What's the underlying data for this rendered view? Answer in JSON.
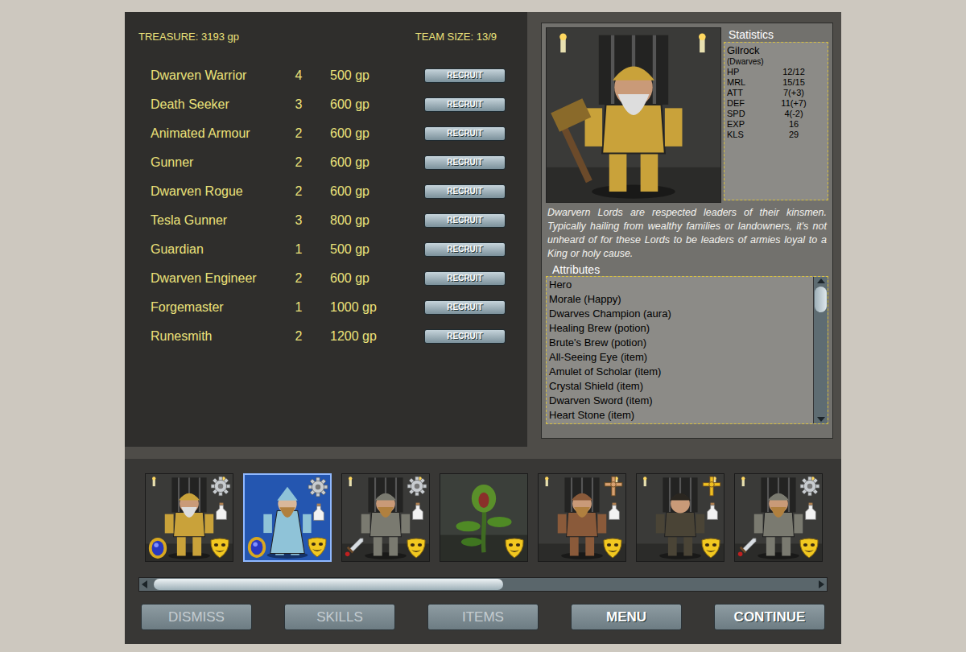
{
  "header": {
    "treasure": "TREASURE: 3193 gp",
    "team_size": "TEAM SIZE: 13/9"
  },
  "recruits": [
    {
      "name": "Dwarven Warrior",
      "count": "4",
      "price": "500 gp",
      "button": "RECRUIT"
    },
    {
      "name": "Death Seeker",
      "count": "3",
      "price": "600 gp",
      "button": "RECRUIT"
    },
    {
      "name": "Animated Armour",
      "count": "2",
      "price": "600 gp",
      "button": "RECRUIT"
    },
    {
      "name": "Gunner",
      "count": "2",
      "price": "600 gp",
      "button": "RECRUIT"
    },
    {
      "name": "Dwarven Rogue",
      "count": "2",
      "price": "600 gp",
      "button": "RECRUIT"
    },
    {
      "name": "Tesla Gunner",
      "count": "3",
      "price": "800 gp",
      "button": "RECRUIT"
    },
    {
      "name": "Guardian",
      "count": "1",
      "price": "500 gp",
      "button": "RECRUIT"
    },
    {
      "name": "Dwarven Engineer",
      "count": "2",
      "price": "600 gp",
      "button": "RECRUIT"
    },
    {
      "name": "Forgemaster",
      "count": "1",
      "price": "1000 gp",
      "button": "RECRUIT"
    },
    {
      "name": "Runesmith",
      "count": "2",
      "price": "1200 gp",
      "button": "RECRUIT"
    }
  ],
  "unit": {
    "name": "Gilrock",
    "faction": "(Dwarves)",
    "stats_title": "Statistics",
    "stats": [
      {
        "label": "HP",
        "value": "12/12"
      },
      {
        "label": "MRL",
        "value": "15/15"
      },
      {
        "label": "ATT",
        "value": "7(+3)"
      },
      {
        "label": "DEF",
        "value": "11(+7)"
      },
      {
        "label": "SPD",
        "value": "4(-2)"
      },
      {
        "label": "EXP",
        "value": "16"
      },
      {
        "label": "KLS",
        "value": "29"
      }
    ],
    "description": "Dwarvern Lords are respected leaders of their kinsmen. Typically hailing from wealthy families or landowners, it's not unheard of for these Lords to be leaders of armies loyal to a King or holy cause.",
    "attributes_title": "Attributes",
    "attributes": [
      "Hero",
      "Morale (Happy)",
      "Dwarves Champion (aura)",
      "Healing Brew (potion)",
      "Brute's Brew (potion)",
      "All-Seeing Eye (item)",
      "Amulet of Scholar (item)",
      "Crystal Shield (item)",
      "Dwarven Sword (item)",
      "Heart Stone (item)"
    ],
    "attributes_scroll": {
      "level": 0.2
    }
  },
  "team": {
    "scroll": {
      "level": 0.53
    },
    "portraits": [
      {
        "kind": "lord",
        "selected": false,
        "badges": [
          "gear",
          "potion",
          "amulet",
          "mask"
        ]
      },
      {
        "kind": "mage",
        "selected": true,
        "badges": [
          "gear",
          "potion",
          "amulet",
          "mask"
        ]
      },
      {
        "kind": "warrior",
        "selected": false,
        "badges": [
          "gear",
          "potion",
          "sword",
          "mask"
        ]
      },
      {
        "kind": "plant",
        "selected": false,
        "badges": [
          "mask"
        ]
      },
      {
        "kind": "priest",
        "selected": false,
        "badges": [
          "cross",
          "potion",
          "mask"
        ]
      },
      {
        "kind": "rogue",
        "selected": false,
        "badges": [
          "goldcross",
          "potion",
          "mask"
        ]
      },
      {
        "kind": "warrior",
        "selected": false,
        "badges": [
          "gear",
          "potion",
          "sword",
          "mask"
        ]
      }
    ]
  },
  "buttons": [
    {
      "label": "DISMISS",
      "disabled": true
    },
    {
      "label": "SKILLS",
      "disabled": true
    },
    {
      "label": "ITEMS",
      "disabled": true
    },
    {
      "label": "MENU",
      "disabled": false
    },
    {
      "label": "CONTINUE",
      "disabled": false
    }
  ]
}
